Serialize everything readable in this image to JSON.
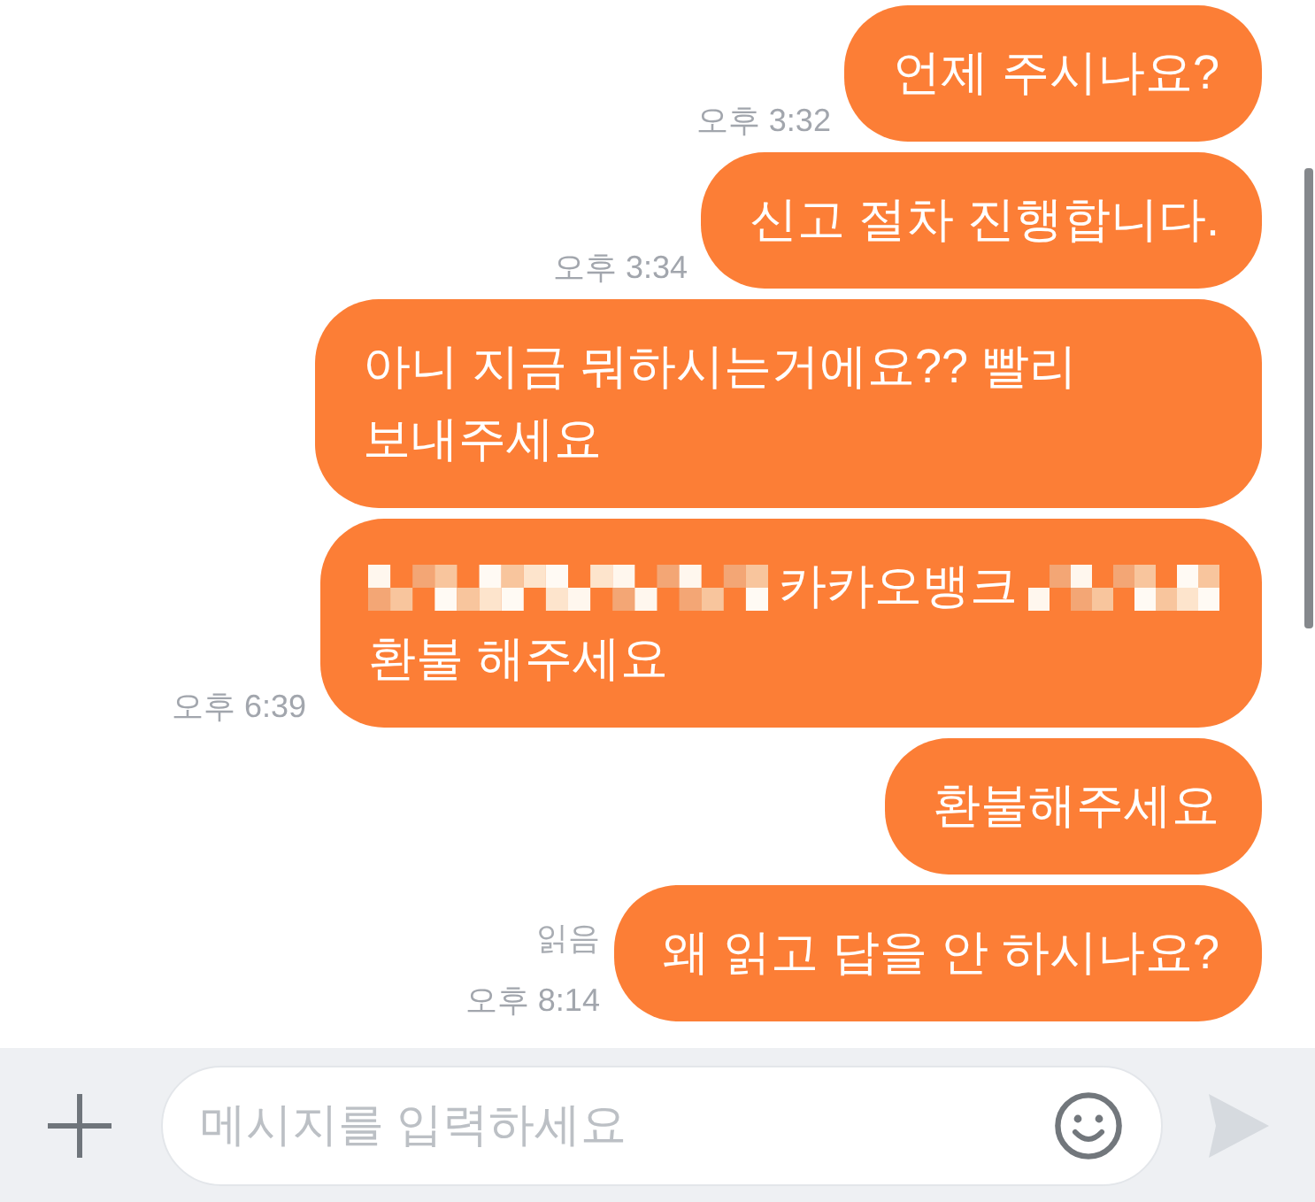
{
  "messages": [
    {
      "lines": [
        [
          {
            "kind": "text",
            "text": "언제 주시나요?"
          }
        ]
      ],
      "time": "오후 3:32"
    },
    {
      "lines": [
        [
          {
            "kind": "text",
            "text": "신고 절차 진행합니다."
          }
        ]
      ],
      "time": "오후 3:34"
    },
    {
      "lines": [
        [
          {
            "kind": "text",
            "text": "아니 지금 뭐하시는거에요?? 빨리 보내주세요"
          }
        ]
      ]
    },
    {
      "lines": [
        [
          {
            "kind": "mosaic"
          },
          {
            "kind": "text",
            "text": "카카오뱅크"
          },
          {
            "kind": "mosaic"
          }
        ],
        [
          {
            "kind": "text",
            "text": "환불 해주세요"
          }
        ]
      ],
      "time": "오후 6:39"
    },
    {
      "lines": [
        [
          {
            "kind": "text",
            "text": "환불해주세요"
          }
        ]
      ]
    },
    {
      "lines": [
        [
          {
            "kind": "text",
            "text": "왜 읽고 답을 안 하시나요?"
          }
        ]
      ],
      "read_label": "읽음",
      "time": "오후 8:14"
    }
  ],
  "composer": {
    "placeholder": "메시지를 입력하세요"
  }
}
